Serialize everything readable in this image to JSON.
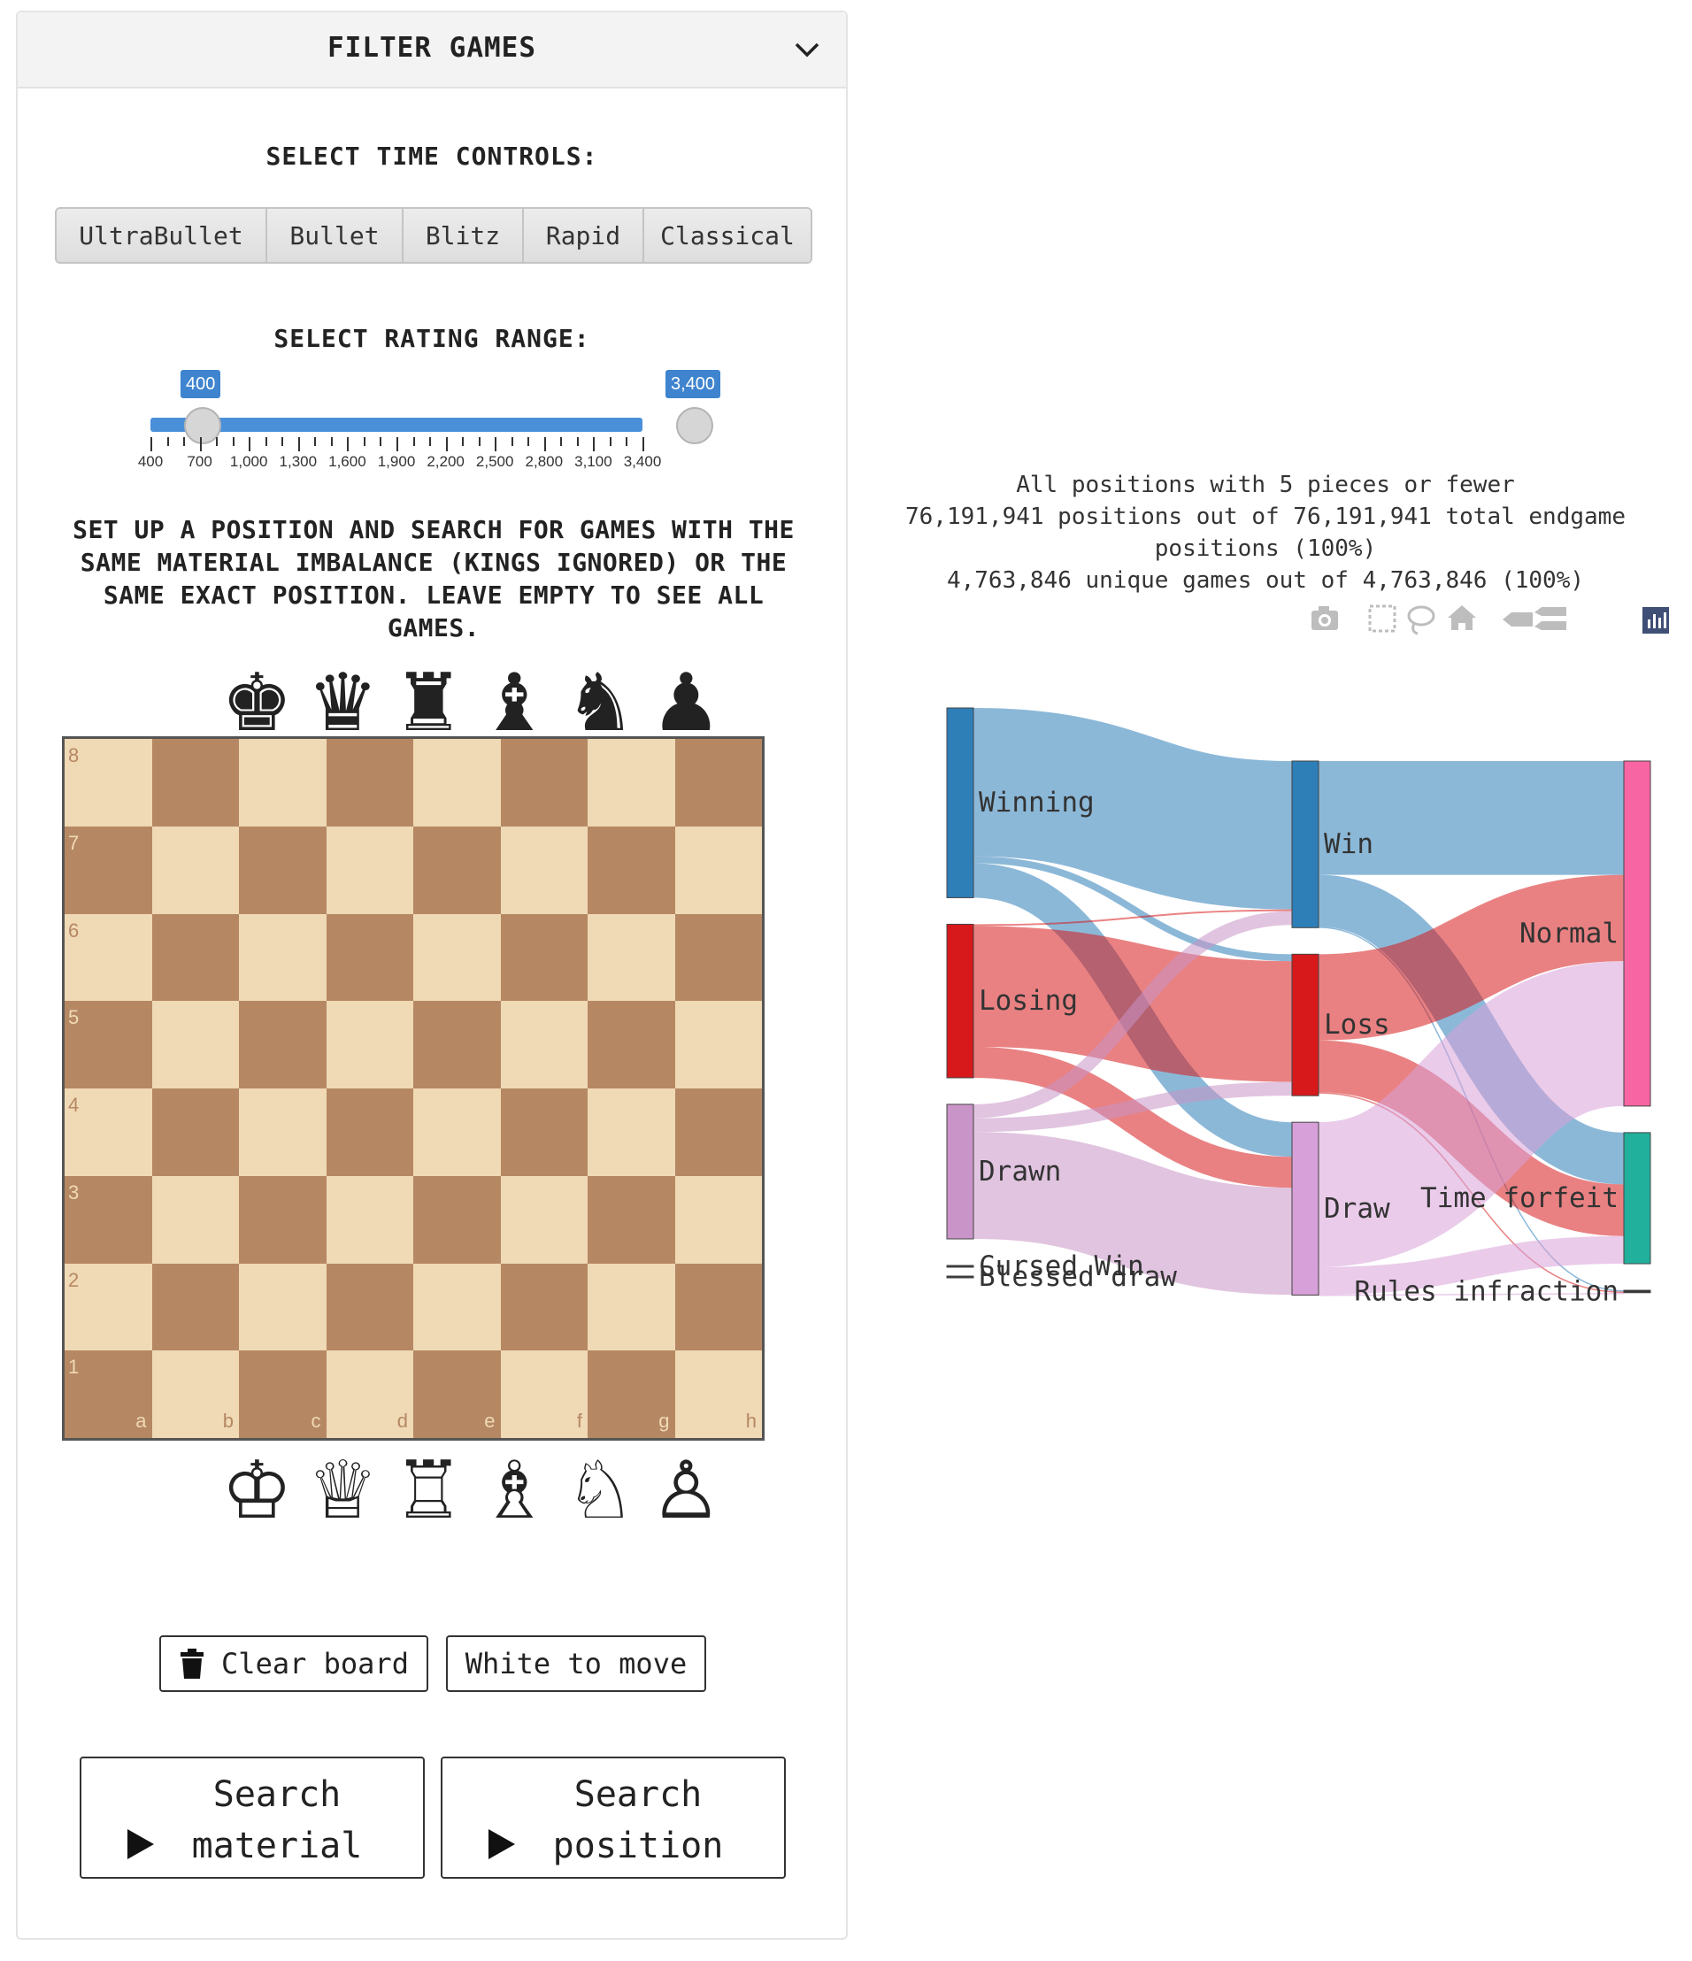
{
  "filter": {
    "title": "FILTER GAMES",
    "time_controls_label": "SELECT TIME CONTROLS:",
    "time_controls": [
      "UltraBullet",
      "Bullet",
      "Blitz",
      "Rapid",
      "Classical"
    ],
    "rating_label": "SELECT RATING RANGE:",
    "rating_min": "400",
    "rating_max": "3,400",
    "rating_ticks": [
      "400",
      "700",
      "1,000",
      "1,300",
      "1,600",
      "1,900",
      "2,200",
      "2,500",
      "2,800",
      "3,100",
      "3,400"
    ],
    "instructions": "SET UP A POSITION AND SEARCH FOR GAMES WITH THE SAME MATERIAL IMBALANCE (KINGS IGNORED) OR THE SAME EXACT POSITION. LEAVE EMPTY TO SEE ALL GAMES."
  },
  "board": {
    "black_pieces": [
      "♚",
      "♛",
      "♜",
      "♝",
      "♞",
      "♟"
    ],
    "white_pieces": [
      "♔",
      "♕",
      "♖",
      "♗",
      "♘",
      "♙"
    ],
    "ranks": [
      "8",
      "7",
      "6",
      "5",
      "4",
      "3",
      "2",
      "1"
    ],
    "files": [
      "a",
      "b",
      "c",
      "d",
      "e",
      "f",
      "g",
      "h"
    ],
    "light_color": "#f0d9b5",
    "dark_color": "#b58863"
  },
  "actions": {
    "clear_board": "Clear board",
    "side_to_move": "White to move",
    "search_material": "Search material",
    "search_position": "Search position"
  },
  "chart_header": {
    "line1": "All positions with 5 pieces or fewer",
    "line2": "76,191,941 positions out of 76,191,941 total endgame",
    "line3": "positions (100%)",
    "line4": "4,763,846 unique games out of 4,763,846 (100%)"
  },
  "modebar_icons": [
    "camera-icon",
    "box-select-icon",
    "lasso-icon",
    "home-icon",
    "hover-closest-icon",
    "hover-compare-icon",
    "plotly-logo-icon"
  ],
  "chart_data": {
    "type": "sankey",
    "nodes": [
      {
        "id": "winning",
        "label": "Winning",
        "color": "#2e7eb8"
      },
      {
        "id": "losing",
        "label": "Losing",
        "color": "#d7191c"
      },
      {
        "id": "drawn",
        "label": "Drawn",
        "color": "#c994c7"
      },
      {
        "id": "cursed",
        "label": "Cursed Win",
        "color": "#333333"
      },
      {
        "id": "blessed",
        "label": "Blessed draw",
        "color": "#333333"
      },
      {
        "id": "win",
        "label": "Win",
        "color": "#2e7eb8"
      },
      {
        "id": "loss",
        "label": "Loss",
        "color": "#d7191c"
      },
      {
        "id": "draw",
        "label": "Draw",
        "color": "#d8a0d8"
      },
      {
        "id": "normal",
        "label": "Normal",
        "color": "#f765a3"
      },
      {
        "id": "timeforfeit",
        "label": "Time forfeit",
        "color": "#20b09c"
      },
      {
        "id": "rules",
        "label": "Rules infraction",
        "color": "#333333"
      }
    ],
    "links": [
      {
        "source": "winning",
        "target": "win",
        "value": 43
      },
      {
        "source": "winning",
        "target": "loss",
        "value": 2
      },
      {
        "source": "winning",
        "target": "draw",
        "value": 10
      },
      {
        "source": "losing",
        "target": "win",
        "value": 0.5
      },
      {
        "source": "losing",
        "target": "loss",
        "value": 35
      },
      {
        "source": "losing",
        "target": "draw",
        "value": 9
      },
      {
        "source": "drawn",
        "target": "win",
        "value": 4
      },
      {
        "source": "drawn",
        "target": "loss",
        "value": 4
      },
      {
        "source": "drawn",
        "target": "draw",
        "value": 31
      },
      {
        "source": "win",
        "target": "normal",
        "value": 33
      },
      {
        "source": "win",
        "target": "timeforfeit",
        "value": 15
      },
      {
        "source": "win",
        "target": "rules",
        "value": 0.3
      },
      {
        "source": "loss",
        "target": "normal",
        "value": 25
      },
      {
        "source": "loss",
        "target": "timeforfeit",
        "value": 15
      },
      {
        "source": "loss",
        "target": "rules",
        "value": 0.3
      },
      {
        "source": "draw",
        "target": "normal",
        "value": 42
      },
      {
        "source": "draw",
        "target": "timeforfeit",
        "value": 8
      },
      {
        "source": "draw",
        "target": "rules",
        "value": 0.1
      }
    ]
  }
}
